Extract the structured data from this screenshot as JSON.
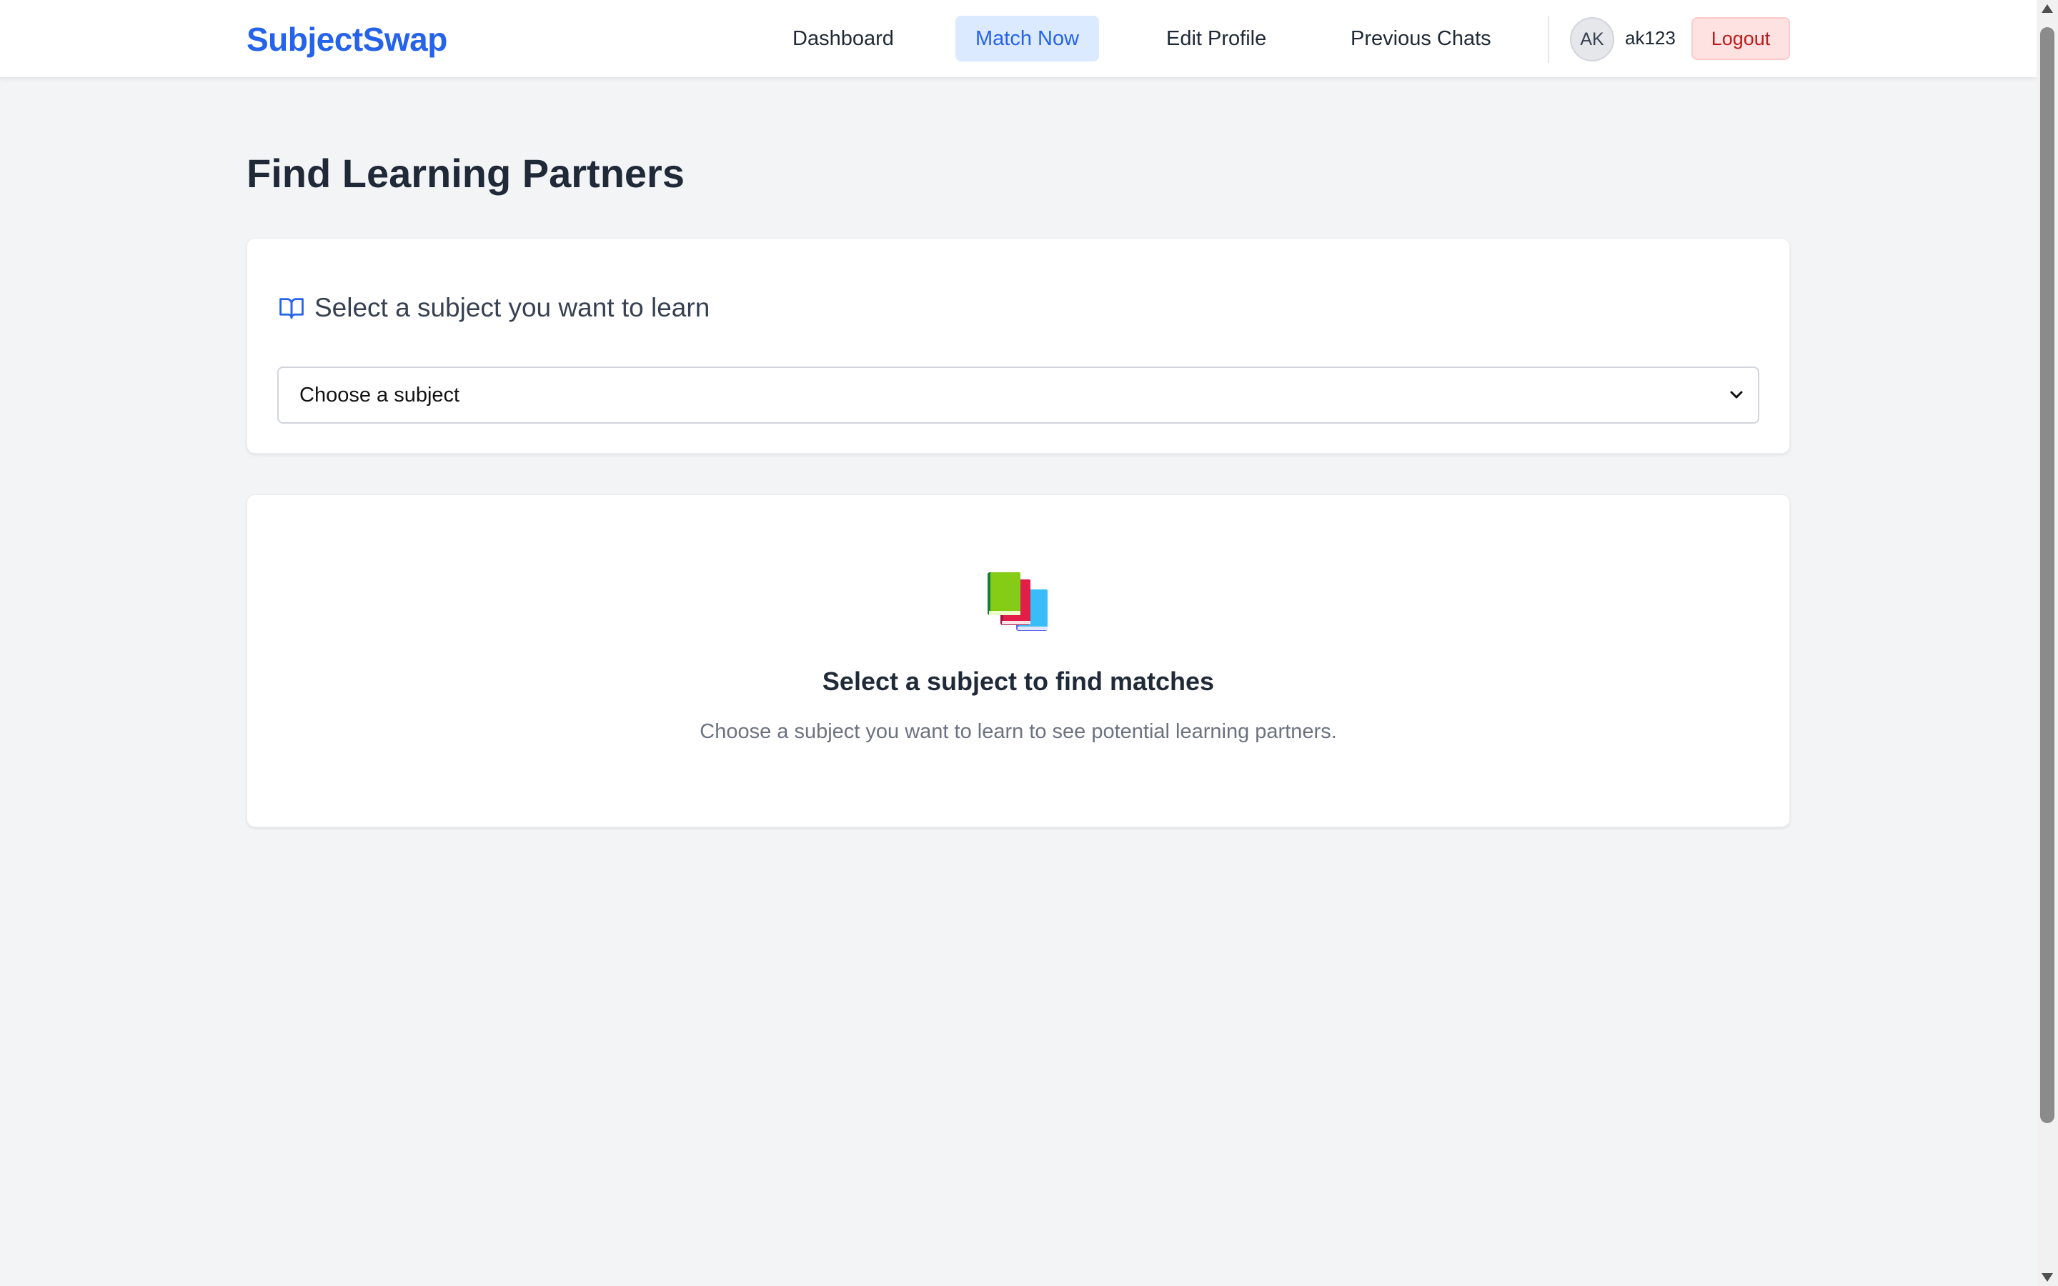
{
  "nav": {
    "brand": "SubjectSwap",
    "links": [
      {
        "label": "Dashboard",
        "active": false
      },
      {
        "label": "Match Now",
        "active": true
      },
      {
        "label": "Edit Profile",
        "active": false
      },
      {
        "label": "Previous Chats",
        "active": false
      }
    ],
    "user": {
      "initials": "AK",
      "username": "ak123"
    },
    "logout_label": "Logout"
  },
  "page": {
    "title": "Find Learning Partners"
  },
  "subject_card": {
    "icon": "book-open-icon",
    "heading": "Select a subject you want to learn",
    "select": {
      "value": "Choose a subject"
    }
  },
  "empty_state": {
    "icon": "books-icon",
    "title": "Select a subject to find matches",
    "text": "Choose a subject you want to learn to see potential learning partners."
  },
  "colors": {
    "brand": "#2563eb",
    "active_bg": "#dbeafe",
    "logout_bg": "#fee2e2",
    "logout_text": "#b91c1c",
    "page_bg": "#f3f4f6"
  }
}
